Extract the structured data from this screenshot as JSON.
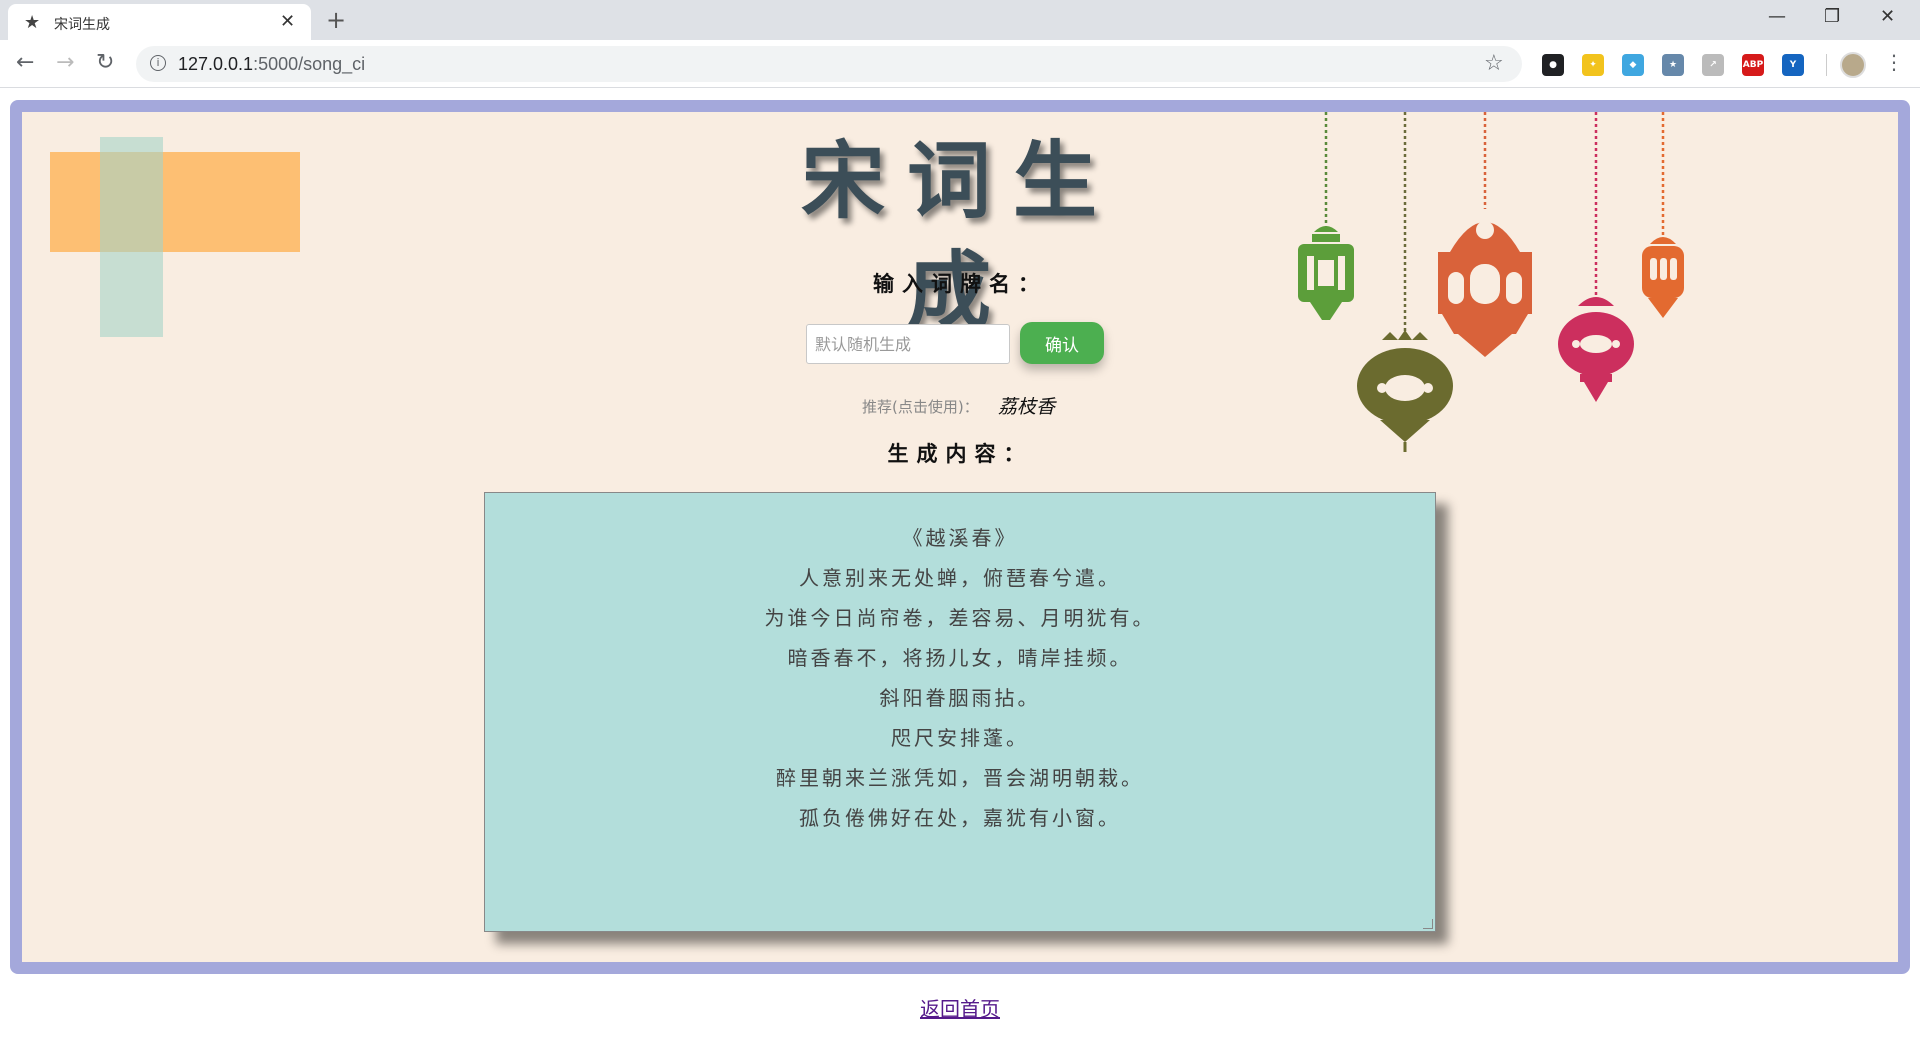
{
  "browser": {
    "tab_title": "宋词生成",
    "tab_icon": "star-icon",
    "url_host": "127.0.0.1",
    "url_path": ":5000/song_ci",
    "extensions": [
      {
        "name": "extension-1-icon",
        "color": "#202124",
        "glyph": "●"
      },
      {
        "name": "extension-2-icon",
        "color": "#f2c31d",
        "glyph": "✦"
      },
      {
        "name": "extension-3-icon",
        "color": "#3fa7e0",
        "glyph": "◆"
      },
      {
        "name": "extension-4-icon",
        "color": "#6688aa",
        "glyph": "★"
      },
      {
        "name": "extension-5-icon",
        "color": "#bbbbbb",
        "glyph": "↗"
      },
      {
        "name": "adblock-icon",
        "color": "#d61a1a",
        "glyph": "ABP"
      },
      {
        "name": "extension-7-icon",
        "color": "#1565c0",
        "glyph": "Y"
      }
    ]
  },
  "page": {
    "title": "宋词生成",
    "input_label": "输入词牌名：",
    "input_placeholder": "默认随机生成",
    "confirm_button": "确认",
    "recommend_label": "推荐(点击使用)：",
    "recommend_value": "荔枝香",
    "output_label": "生成内容：",
    "poem_lines": [
      "《越溪春》",
      "人意别来无处蝉，俯琶春兮遣。",
      "为谁今日尚帘卷，差容易、月明犹有。",
      "暗香春不，将扬儿女，晴岸挂频。",
      "斜阳眷胭雨拈。",
      "咫尺安排蓬。",
      "醉里朝来兰涨凭如，晋会湖明朝栽。",
      "孤负倦佛好在处，嘉犹有小窗。"
    ],
    "home_link": "返回首页"
  },
  "colors": {
    "frame": "#a4a8db",
    "canvas": "#f9ede1",
    "output_bg": "#b3dedb",
    "button": "#4caf50"
  }
}
